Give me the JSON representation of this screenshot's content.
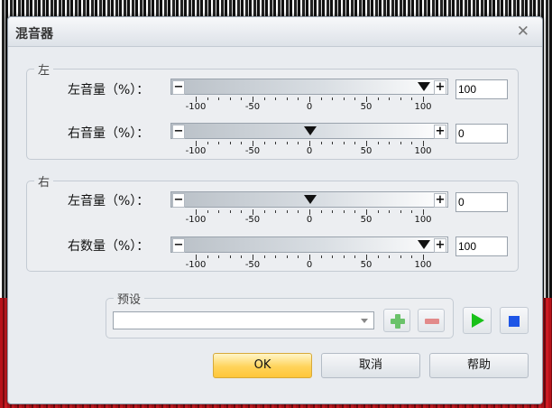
{
  "dialog": {
    "title": "混音器"
  },
  "groups": {
    "left": {
      "legend": "左",
      "rows": [
        {
          "label": "左音量（%）：",
          "value": "100",
          "level": 100
        },
        {
          "label": "右音量（%）：",
          "value": "0",
          "level": 0
        }
      ]
    },
    "right": {
      "legend": "右",
      "rows": [
        {
          "label": "左音量（%）：",
          "value": "0",
          "level": 0
        },
        {
          "label": "右数量（%）：",
          "value": "100",
          "level": 100
        }
      ]
    }
  },
  "scale": {
    "labels": [
      "-100",
      "-50",
      "0",
      "50",
      "100"
    ]
  },
  "slider_buttons": {
    "minus": "−",
    "plus": "+"
  },
  "preset": {
    "legend": "预设",
    "value": ""
  },
  "buttons": {
    "ok": "OK",
    "cancel": "取消",
    "help": "帮助"
  },
  "colors": {
    "ok_button": "#ffd35a",
    "add_green": "#6ac26a",
    "remove_red": "#e28a8a",
    "play_green": "#19c119",
    "stop_blue": "#1d55e6"
  }
}
